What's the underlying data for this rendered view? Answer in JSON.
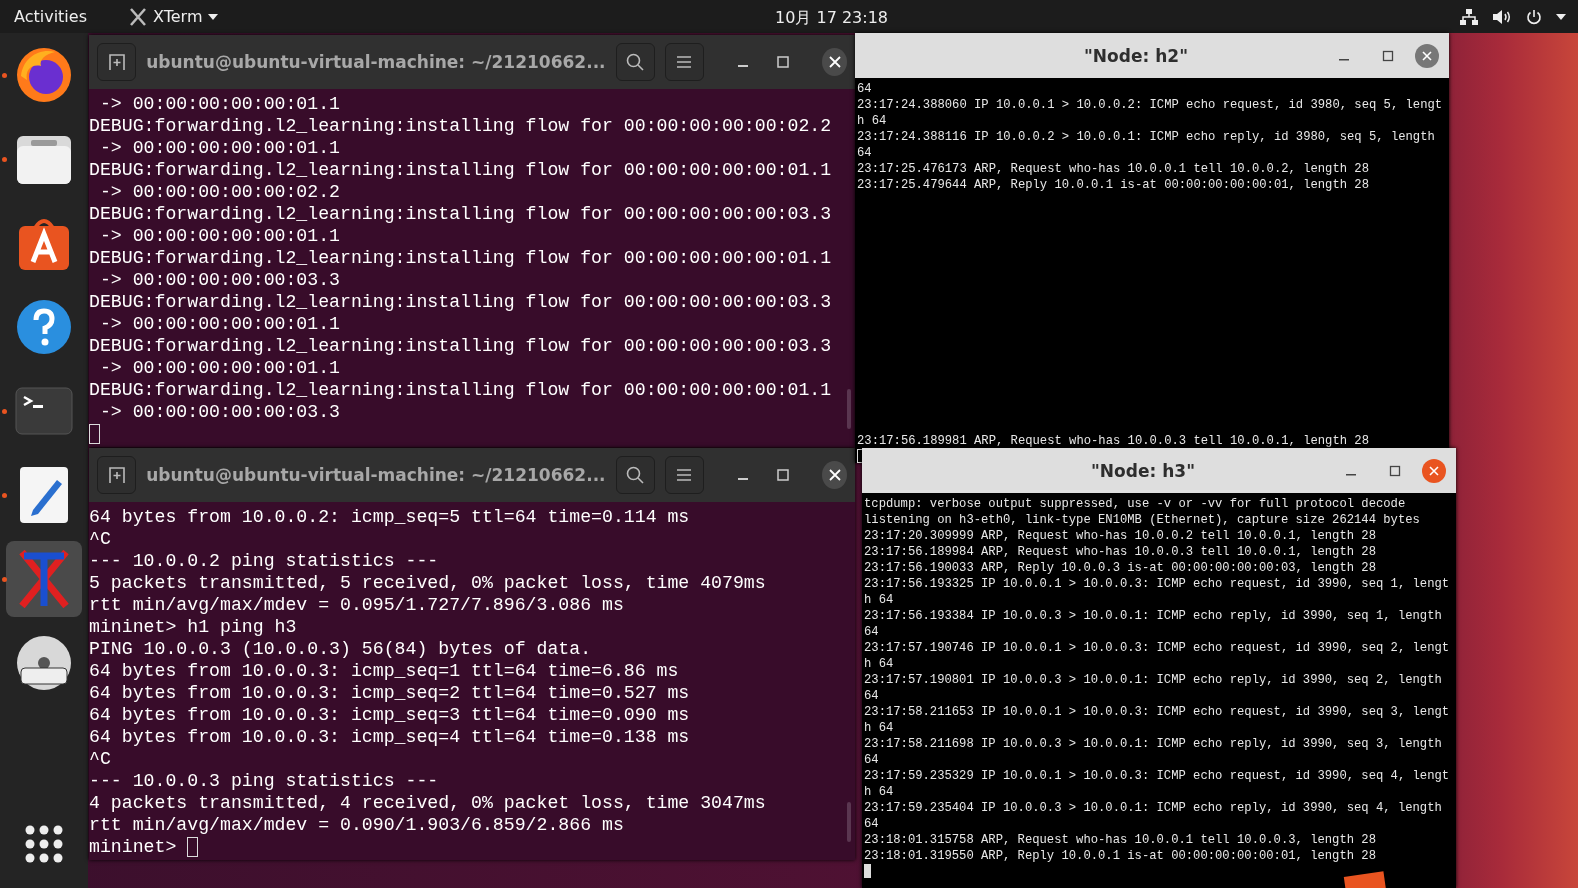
{
  "top_bar": {
    "activities": "Activities",
    "app_menu": "XTerm",
    "clock": "10月 17  23:18"
  },
  "dock": {
    "items": [
      {
        "kind": "firefox",
        "running": true,
        "selected": false
      },
      {
        "kind": "files",
        "running": true,
        "selected": false
      },
      {
        "kind": "software",
        "running": false,
        "selected": false
      },
      {
        "kind": "help",
        "running": false,
        "selected": false
      },
      {
        "kind": "terminal",
        "running": true,
        "selected": false
      },
      {
        "kind": "editor",
        "running": true,
        "selected": false
      },
      {
        "kind": "xterm",
        "running": true,
        "selected": true
      },
      {
        "kind": "dvd",
        "running": false,
        "selected": false
      }
    ]
  },
  "terminals": [
    {
      "title": "ubuntu@ubuntu-virtual-machine: ~/21210662...",
      "lines": [
        " -> 00:00:00:00:00:01.1",
        "DEBUG:forwarding.l2_learning:installing flow for 00:00:00:00:00:02.2",
        " -> 00:00:00:00:00:01.1",
        "DEBUG:forwarding.l2_learning:installing flow for 00:00:00:00:00:01.1",
        " -> 00:00:00:00:00:02.2",
        "DEBUG:forwarding.l2_learning:installing flow for 00:00:00:00:00:03.3",
        " -> 00:00:00:00:00:01.1",
        "DEBUG:forwarding.l2_learning:installing flow for 00:00:00:00:00:01.1",
        " -> 00:00:00:00:00:03.3",
        "DEBUG:forwarding.l2_learning:installing flow for 00:00:00:00:00:03.3",
        " -> 00:00:00:00:00:01.1",
        "DEBUG:forwarding.l2_learning:installing flow for 00:00:00:00:00:03.3",
        " -> 00:00:00:00:00:01.1",
        "DEBUG:forwarding.l2_learning:installing flow for 00:00:00:00:00:01.1",
        " -> 00:00:00:00:00:03.3"
      ]
    },
    {
      "title": "ubuntu@ubuntu-virtual-machine: ~/21210662...",
      "lines": [
        "64 bytes from 10.0.0.2: icmp_seq=5 ttl=64 time=0.114 ms",
        "^C",
        "--- 10.0.0.2 ping statistics ---",
        "5 packets transmitted, 5 received, 0% packet loss, time 4079ms",
        "rtt min/avg/max/mdev = 0.095/1.727/7.896/3.086 ms",
        "mininet> h1 ping h3",
        "PING 10.0.0.3 (10.0.0.3) 56(84) bytes of data.",
        "64 bytes from 10.0.0.3: icmp_seq=1 ttl=64 time=6.86 ms",
        "64 bytes from 10.0.0.3: icmp_seq=2 ttl=64 time=0.527 ms",
        "64 bytes from 10.0.0.3: icmp_seq=3 ttl=64 time=0.090 ms",
        "64 bytes from 10.0.0.3: icmp_seq=4 ttl=64 time=0.138 ms",
        "^C",
        "--- 10.0.0.3 ping statistics ---",
        "4 packets transmitted, 4 received, 0% packet loss, time 3047ms",
        "rtt min/avg/max/mdev = 0.090/1.903/6.859/2.866 ms"
      ],
      "prompt": "mininet> "
    }
  ],
  "xterms": [
    {
      "title": "\"Node: h2\"",
      "focused": false,
      "output_blocks": [
        [
          "64",
          "23:17:24.388060 IP 10.0.0.1 > 10.0.0.2: ICMP echo request, id 3980, seq 5, lengt",
          "h 64",
          "23:17:24.388116 IP 10.0.0.2 > 10.0.0.1: ICMP echo reply, id 3980, seq 5, length",
          "64",
          "23:17:25.476173 ARP, Request who-has 10.0.0.1 tell 10.0.0.2, length 28",
          "23:17:25.479644 ARP, Reply 10.0.0.1 is-at 00:00:00:00:00:01, length 28"
        ],
        [
          "23:17:56.189981 ARP, Request who-has 10.0.0.3 tell 10.0.0.1, length 28"
        ]
      ]
    },
    {
      "title": "\"Node: h3\"",
      "focused": true,
      "output_blocks": [
        [
          "tcpdump: verbose output suppressed, use -v or -vv for full protocol decode",
          "listening on h3-eth0, link-type EN10MB (Ethernet), capture size 262144 bytes",
          "23:17:20.309999 ARP, Request who-has 10.0.0.2 tell 10.0.0.1, length 28",
          "23:17:56.189984 ARP, Request who-has 10.0.0.3 tell 10.0.0.1, length 28",
          "23:17:56.190033 ARP, Reply 10.0.0.3 is-at 00:00:00:00:00:03, length 28",
          "23:17:56.193325 IP 10.0.0.1 > 10.0.0.3: ICMP echo request, id 3990, seq 1, lengt",
          "h 64",
          "23:17:56.193384 IP 10.0.0.3 > 10.0.0.1: ICMP echo reply, id 3990, seq 1, length",
          "64",
          "23:17:57.190746 IP 10.0.0.1 > 10.0.0.3: ICMP echo request, id 3990, seq 2, lengt",
          "h 64",
          "23:17:57.190801 IP 10.0.0.3 > 10.0.0.1: ICMP echo reply, id 3990, seq 2, length",
          "64",
          "23:17:58.211653 IP 10.0.0.1 > 10.0.0.3: ICMP echo request, id 3990, seq 3, lengt",
          "h 64",
          "23:17:58.211698 IP 10.0.0.3 > 10.0.0.1: ICMP echo reply, id 3990, seq 3, length",
          "64",
          "23:17:59.235329 IP 10.0.0.1 > 10.0.0.3: ICMP echo request, id 3990, seq 4, lengt",
          "h 64",
          "23:17:59.235404 IP 10.0.0.3 > 10.0.0.1: ICMP echo reply, id 3990, seq 4, length",
          "64",
          "23:18:01.315758 ARP, Request who-has 10.0.0.1 tell 10.0.0.3, length 28",
          "23:18:01.319550 ARP, Reply 10.0.0.1 is-at 00:00:00:00:00:01, length 28"
        ]
      ]
    }
  ]
}
